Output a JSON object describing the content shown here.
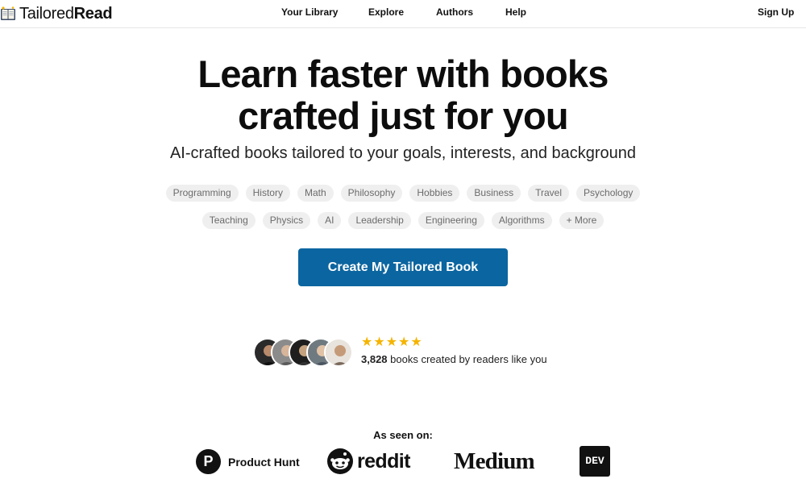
{
  "brand": {
    "name_light": "Tailored",
    "name_bold": "Read",
    "logo_icon": "open-book-icon"
  },
  "nav": {
    "items": [
      {
        "label": "Your Library"
      },
      {
        "label": "Explore"
      },
      {
        "label": "Authors"
      },
      {
        "label": "Help"
      }
    ],
    "signup_label": "Sign Up"
  },
  "hero": {
    "title_line1": "Learn faster with books",
    "title_line2": "crafted just for you",
    "subtitle": "AI-crafted books tailored to your goals, interests, and background"
  },
  "topics": {
    "row1": [
      "Programming",
      "History",
      "Math",
      "Philosophy",
      "Hobbies",
      "Business",
      "Travel",
      "Psychology"
    ],
    "row2": [
      "Teaching",
      "Physics",
      "AI",
      "Leadership",
      "Engineering",
      "Algorithms",
      "+ More"
    ]
  },
  "cta": {
    "label": "Create My Tailored Book",
    "color": "#0b65a0"
  },
  "social_proof": {
    "rating_stars": 5,
    "star_color": "#f5b400",
    "count": "3,828",
    "text": "books created by readers like you"
  },
  "seen_on": {
    "label": "As seen on:",
    "brands": {
      "product_hunt": {
        "mark": "P",
        "name": "Product Hunt"
      },
      "reddit": {
        "name": "reddit"
      },
      "medium": {
        "name": "Medium"
      },
      "dev": {
        "name": "DEV"
      }
    }
  }
}
